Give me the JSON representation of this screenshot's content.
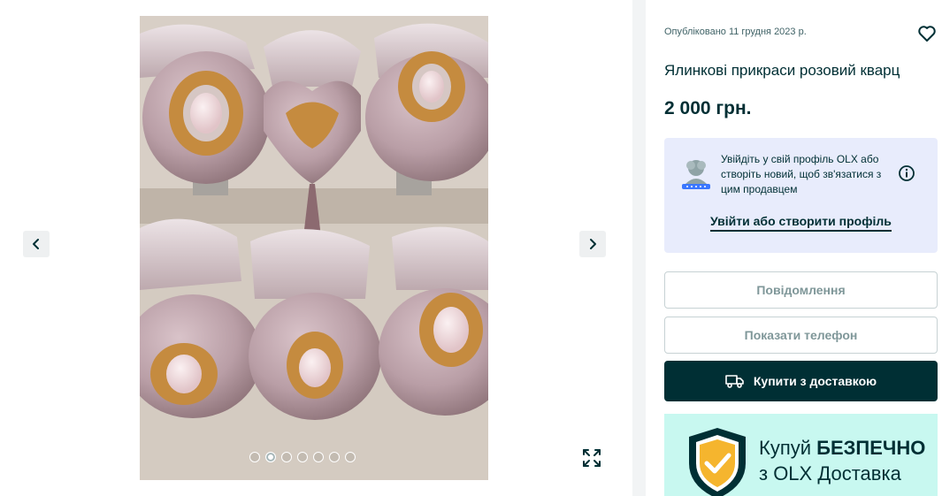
{
  "listing": {
    "published": "Опубліковано 11 грудня 2023 р.",
    "title": "Ялинкові прикраси розовий кварц",
    "price": "2 000 грн."
  },
  "gallery": {
    "dots_count": 7,
    "active_dot": 2
  },
  "login_prompt": {
    "text": "Увійдіть у свій профіль OLX або створіть новий, щоб зв'язатися з цим продавцем",
    "link_label": "Увійти або створити профіль"
  },
  "actions": {
    "message_label": "Повідомлення",
    "phone_label": "Показати телефон",
    "buy_label": "Купити з доставкою"
  },
  "promo": {
    "line1_prefix": "Купуй",
    "line1_bold": "БЕЗПЕЧНО",
    "line2": "з OLX Доставка"
  },
  "colors": {
    "brand_dark": "#002f34",
    "login_bg": "#e8ecfc",
    "promo_bg": "#c8f8f0",
    "shield_gold": "#f5b52e"
  }
}
